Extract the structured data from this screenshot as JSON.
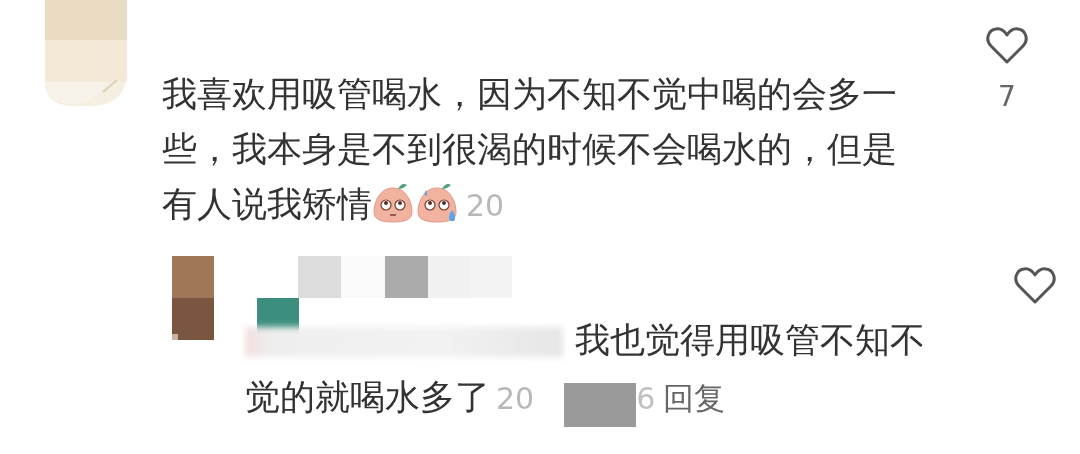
{
  "comments": [
    {
      "avatar": {
        "kind": "picture"
      },
      "username": {
        "kind": "hidden"
      },
      "lead": {
        "kind": "none"
      },
      "lines": [
        "我喜欢用吸管喝水，因为不知不觉中喝的会多一",
        "些，我本身是不到很渴的时候不会喝水的，但是",
        "有人说我矫情"
      ],
      "emojis": [
        {
          "kind": "eye-roll"
        },
        {
          "kind": "sweat"
        }
      ],
      "time_start": "20",
      "like": {
        "kind": "heart",
        "count": "7"
      }
    },
    {
      "avatar": {
        "kind": "mosaic"
      },
      "username": {
        "kind": "mosaic"
      },
      "lead": {
        "kind": "blurred"
      },
      "lines": [
        "我也觉得用吸管不知不",
        "觉的就喝水多了"
      ],
      "time_start": "20",
      "time_end": "6",
      "reply": "回复",
      "like": {
        "kind": "heart"
      }
    }
  ]
}
